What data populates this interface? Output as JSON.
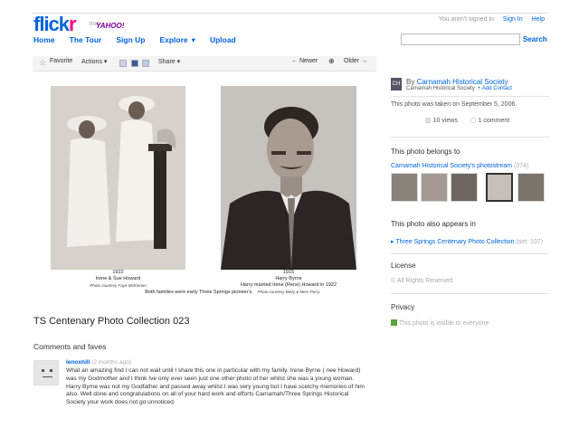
{
  "header": {
    "logo_fl": "flick",
    "logo_r": "r",
    "from": "from",
    "yahoo": "YAHOO!",
    "signed_status": "You aren't signed in",
    "sign_in": "Sign In",
    "help": "Help",
    "nav": [
      "Home",
      "The Tour",
      "Sign Up",
      "Explore",
      "Upload"
    ],
    "search_label": "Search"
  },
  "toolbar": {
    "favorite": "Favorite",
    "actions": "Actions",
    "share": "Share",
    "newer": "← Newer",
    "older": "Older →"
  },
  "photos": {
    "left": {
      "year": "1922",
      "names": "Irene & Sue Howard",
      "courtesy": "Photo courtesy Faye McKinnon"
    },
    "right": {
      "year": "1915",
      "names": "Harry Byrne",
      "married": "Harry married Irene (Rene) Howard in 1922",
      "courtesy": "Photo courtesy Betty & Merv Perry"
    },
    "footer": "Both families were early Three Springs pioneer's."
  },
  "main": {
    "title": "TS Centenary Photo Collection 023",
    "comments_heading": "Comments and faves",
    "comment": {
      "user": "lenoxhill",
      "time": "(2 months ago)",
      "text": "What an amazing find I can not wait until I share this one in particular with my family. Irene Byrne ( nee Howard) was my Godmother and I think Ive only ever seen just one other photo of her whilst she was a young woman. Harry Byrne was not my Godfather and passed away whilst I was very young but I have scetchy memories of him also. Well done and congratulations on all of your hard work and efforts Carnamah/Three Springs Historical Society your work does not go unnoticed."
    }
  },
  "sidebar": {
    "owner_initials": "CH",
    "by": "By",
    "owner": "Carnamah Historical Society",
    "owner_small": "Carnamah Historical Society",
    "add_contact": "+ Add Contact",
    "taken": "This photo was taken on September 5, 2006.",
    "views": "10 views",
    "comments": "1 comment",
    "belongs_heading": "This photo belongs to",
    "photostream": "Carnamah Historical Society's photostream",
    "photostream_count": "(374)",
    "appears_heading": "This photo also appears in",
    "set_name": "Three Springs Centenary Photo Collection",
    "set_count": "(set: 107)",
    "license_heading": "License",
    "license": "All Rights Reserved",
    "privacy_heading": "Privacy",
    "privacy": "This photo is visible to everyone"
  },
  "colors": {
    "brand_blue": "#0063dc",
    "brand_pink": "#ff0084"
  }
}
